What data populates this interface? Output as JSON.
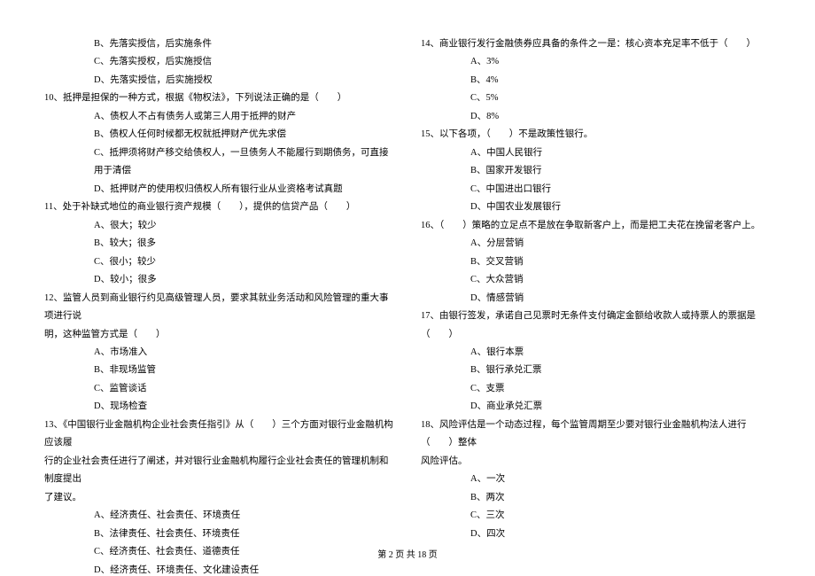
{
  "left": {
    "o_b_9": "B、先落实授信，后实施条件",
    "o_c_9": "C、先落实授权，后实施授信",
    "o_d_9": "D、先落实授信，后实施授权",
    "q10": "10、抵押是担保的一种方式，根据《物权法》，下列说法正确的是（　　）",
    "o_a_10": "A、债权人不占有债务人或第三人用于抵押的财产",
    "o_b_10": "B、债权人任何时候都无权就抵押财产优先求偿",
    "o_c_10": "C、抵押须将财产移交给债权人，一旦债务人不能履行到期债务，可直接用于清偿",
    "o_d_10": "D、抵押财产的使用权归债权人所有银行业从业资格考试真题",
    "q11": "11、处于补缺式地位的商业银行资产规模（　　），提供的信贷产品（　　）",
    "o_a_11": "A、很大；较少",
    "o_b_11": "B、较大；很多",
    "o_c_11": "C、很小；较少",
    "o_d_11": "D、较小；很多",
    "q12": "12、监管人员到商业银行约见高级管理人员，要求其就业务活动和风险管理的重大事项进行说",
    "q12_cont": "明，这种监管方式是（　　）",
    "o_a_12": "A、市场准入",
    "o_b_12": "B、非现场监管",
    "o_c_12": "C、监管谈话",
    "o_d_12": "D、现场检查",
    "q13": "13、《中国银行业金融机构企业社会责任指引》从（　　）三个方面对银行业金融机构应该履",
    "q13_cont": "行的企业社会责任进行了阐述，并对银行业金融机构履行企业社会责任的管理机制和制度提出",
    "q13_cont2": "了建议。",
    "o_a_13": "A、经济责任、社会责任、环境责任",
    "o_b_13": "B、法律责任、社会责任、环境责任",
    "o_c_13": "C、经济责任、社会责任、道德责任",
    "o_d_13": "D、经济责任、环境责任、文化建设责任"
  },
  "right": {
    "q14": "14、商业银行发行金融债券应具备的条件之一是：核心资本充足率不低于（　　）",
    "o_a_14": "A、3%",
    "o_b_14": "B、4%",
    "o_c_14": "C、5%",
    "o_d_14": "D、8%",
    "q15": "15、以下各项，（　　）不是政策性银行。",
    "o_a_15": "A、中国人民银行",
    "o_b_15": "B、国家开发银行",
    "o_c_15": "C、中国进出口银行",
    "o_d_15": "D、中国农业发展银行",
    "q16": "16、（　　）策略的立足点不是放在争取新客户上，而是把工夫花在挽留老客户上。",
    "o_a_16": "A、分层营销",
    "o_b_16": "B、交叉营销",
    "o_c_16": "C、大众营销",
    "o_d_16": "D、情感营销",
    "q17": "17、由银行签发，承诺自己见票时无条件支付确定金额给收款人或持票人的票据是（　　）",
    "o_a_17": "A、银行本票",
    "o_b_17": "B、银行承兑汇票",
    "o_c_17": "C、支票",
    "o_d_17": "D、商业承兑汇票",
    "q18": "18、风险评估是一个动态过程，每个监管周期至少要对银行业金融机构法人进行（　　）整体",
    "q18_cont": "风险评估。",
    "o_a_18": "A、一次",
    "o_b_18": "B、两次",
    "o_c_18": "C、三次",
    "o_d_18": "D、四次"
  },
  "footer": "第 2 页 共 18 页"
}
